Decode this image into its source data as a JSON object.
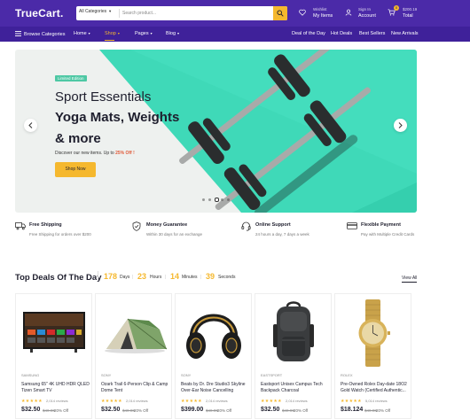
{
  "header": {
    "logo": "TrueCart.",
    "search": {
      "category": "All Categories",
      "placeholder": "Search product..."
    },
    "wishlist": {
      "line1": "Wishlist",
      "line2": "My Items"
    },
    "account": {
      "line1": "Sign In",
      "line2": "Account"
    },
    "cart": {
      "count": "0",
      "total": "$200.19",
      "label": "Total"
    }
  },
  "nav": {
    "browse": "Browse Categories",
    "items": [
      {
        "label": "Home",
        "active": false
      },
      {
        "label": "Shop",
        "active": true
      },
      {
        "label": "Pages",
        "active": false
      },
      {
        "label": "Blog",
        "active": false
      }
    ],
    "right": [
      "Deal of the Day",
      "Hot Deals",
      "Best Sellers",
      "New Arrivals"
    ]
  },
  "hero": {
    "badge": "Limited Edition",
    "line1": "Sport Essentials",
    "line2": "Yoga Mats, Weights",
    "line3": "& more",
    "subtitle_prefix": "Discover our new items. Up to ",
    "subtitle_highlight": "25% Off !",
    "cta": "Shop Now",
    "slide_count": 5,
    "active_slide": 2
  },
  "features": [
    {
      "title": "Free Shipping",
      "desc": "Free Shipping for orders over $200",
      "icon": "truck-icon"
    },
    {
      "title": "Money Guarantee",
      "desc": "Within 30 days for an exchange",
      "icon": "shield-icon"
    },
    {
      "title": "Online Support",
      "desc": "24 hours a day, 7 days a week",
      "icon": "headset-icon"
    },
    {
      "title": "Flexible Payment",
      "desc": "Pay with Multiple Credit Cards",
      "icon": "card-icon"
    }
  ],
  "deals": {
    "title": "Top Deals Of The Day",
    "countdown": {
      "days": "178",
      "days_label": "Days",
      "hours": "23",
      "hours_label": "Hours",
      "minutes": "14",
      "minutes_label": "Minutes",
      "seconds": "39",
      "seconds_label": "Seconds"
    },
    "view_all": "View All",
    "products": [
      {
        "brand": "SAMSUNG",
        "name": "Samsung 65\" 4K UHD HDR QLED Tizen Smart TV",
        "stars": "★★★★★",
        "reviews": "2,014 reviews",
        "price": "$32.50",
        "old": "$40.00",
        "off": "20% Off",
        "image": "tv-image"
      },
      {
        "brand": "SONY",
        "name": "Ozark Trail 6-Person Clip & Camp Dome Tent",
        "stars": "★★★★★",
        "reviews": "2,014 reviews",
        "price": "$32.50",
        "old": "$40.00",
        "off": "20% Off",
        "image": "tent-image"
      },
      {
        "brand": "SONY",
        "name": "Beats by Dr. Dre Studio3 Skyline Over-Ear Noise Cancelling",
        "stars": "★★★★★",
        "reviews": "2,014 reviews",
        "price": "$399.00",
        "old": "$40.00",
        "off": "20% Off",
        "image": "headphones-image"
      },
      {
        "brand": "EASTSPORT",
        "name": "Eastsport Unisex Campus Tech Backpack Charcoal",
        "stars": "★★★★★",
        "reviews": "2,014 reviews",
        "price": "$32.50",
        "old": "$40.00",
        "off": "20% Off",
        "image": "backpack-image"
      },
      {
        "brand": "ROLEX",
        "name": "Pre-Owned Rolex Day-date 18O2 Gold Watch (Certified Authentic...",
        "stars": "★★★★★",
        "reviews": "5,014 reviews",
        "price": "$18.124",
        "old": "$40.00",
        "off": "20% Off",
        "image": "watch-image"
      }
    ]
  },
  "colors": {
    "primary": "#4b2aa8",
    "nav": "#3f219a",
    "accent": "#f5b82e",
    "hero_teal": "#3fd9b8"
  }
}
